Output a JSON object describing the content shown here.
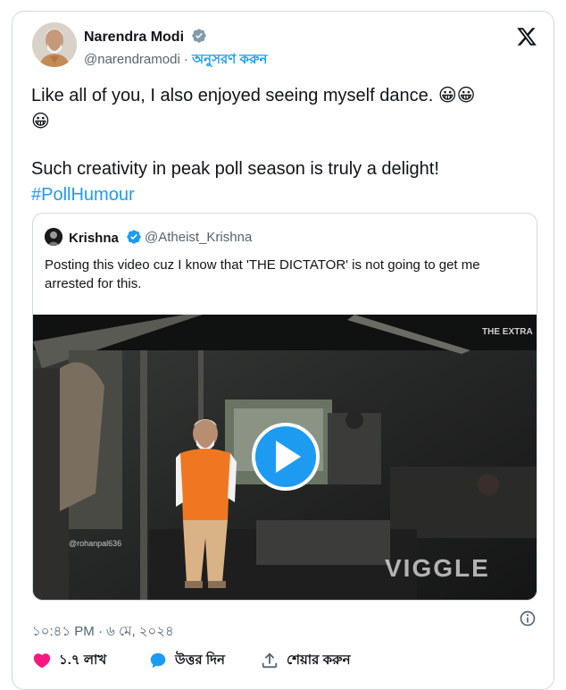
{
  "author": {
    "name": "Narendra Modi",
    "handle": "@narendramodi",
    "separator": "·",
    "follow_label": "অনুসরণ করুন"
  },
  "tweet": {
    "line1": "Like all of you, I also enjoyed seeing myself dance. 😀😀",
    "line2": "😀",
    "line3": "Such creativity in peak poll season is truly a delight!",
    "hashtag": "#PollHumour"
  },
  "quoted": {
    "name": "Krishna",
    "handle": "@Atheist_Krishna",
    "text": "Posting this video cuz I know that 'THE DICTATOR' is not going to get me arrested for this.",
    "video": {
      "watermark_top": "THE EXTRA",
      "watermark_bottom": "VIGGLE",
      "credit": "@rohanpal636"
    }
  },
  "meta": {
    "timestamp": "১০:৪১ PM · ৬ মে, ২০২৪"
  },
  "actions": {
    "likes": "১.৭ লাখ",
    "reply_label": "উত্তর দিন",
    "share_label": "শেয়ার করুন"
  },
  "colors": {
    "accent": "#1d9bf0",
    "like": "#f91880",
    "muted": "#536471",
    "border": "#cfd9de"
  },
  "icons": [
    "verified-badge-icon",
    "x-logo-icon",
    "play-icon",
    "info-icon",
    "heart-icon",
    "reply-bubble-icon",
    "share-icon"
  ]
}
